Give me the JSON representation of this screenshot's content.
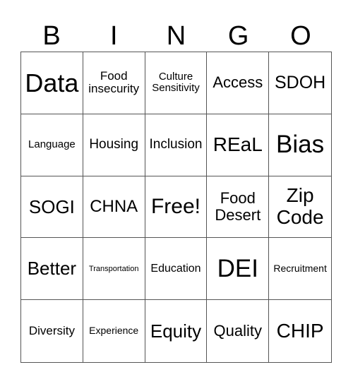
{
  "header": [
    "B",
    "I",
    "N",
    "G",
    "O"
  ],
  "cells": [
    {
      "text": "Data",
      "size": "s36"
    },
    {
      "text": "Food insecurity",
      "size": "s17"
    },
    {
      "text": "Culture Sensitivity",
      "size": "s15"
    },
    {
      "text": "Access",
      "size": "s22"
    },
    {
      "text": "SDOH",
      "size": "s25"
    },
    {
      "text": "Language",
      "size": "s15"
    },
    {
      "text": "Housing",
      "size": "s19"
    },
    {
      "text": "Inclusion",
      "size": "s19"
    },
    {
      "text": "REaL",
      "size": "s28"
    },
    {
      "text": "Bias",
      "size": "s35"
    },
    {
      "text": "SOGI",
      "size": "s26"
    },
    {
      "text": "CHNA",
      "size": "s24"
    },
    {
      "text": "Free!",
      "size": "s30"
    },
    {
      "text": "Food Desert",
      "size": "s22"
    },
    {
      "text": "Zip Code",
      "size": "s28"
    },
    {
      "text": "Better",
      "size": "s26"
    },
    {
      "text": "Transportation",
      "size": "s11"
    },
    {
      "text": "Education",
      "size": "s16"
    },
    {
      "text": "DEI",
      "size": "s35"
    },
    {
      "text": "Recruitment",
      "size": "s14"
    },
    {
      "text": "Diversity",
      "size": "s17"
    },
    {
      "text": "Experience",
      "size": "s14"
    },
    {
      "text": "Equity",
      "size": "s26"
    },
    {
      "text": "Quality",
      "size": "s22"
    },
    {
      "text": "CHIP",
      "size": "s28"
    }
  ]
}
